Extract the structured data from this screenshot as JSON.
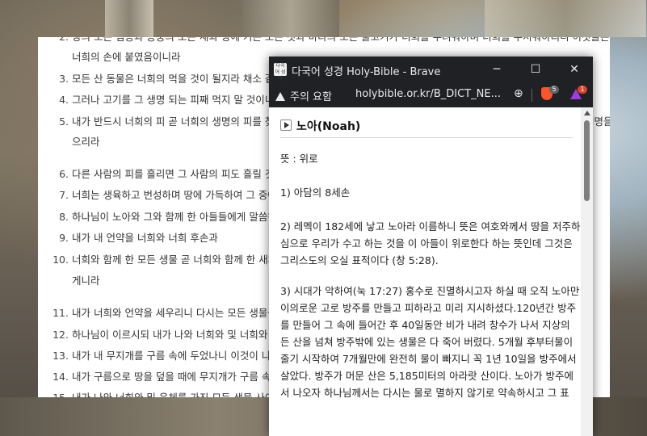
{
  "background_page": {
    "verses": [
      {
        "num": "2.",
        "text": "땅의 모든 짐승과 공중의 모든 새와 땅에 기는 모든 것과 바다의 모든 물고기가 너희를 두려워하며 너희를 무서워하리니 이것들은"
      },
      {
        "num": "",
        "text": "너희의 손에 붙였음이니라"
      },
      {
        "num": "3.",
        "text": "모든 산 동물은 너희의 먹을 것이 될지라 채소 같이 내가 이것을 다 너희에게 주노라"
      },
      {
        "num": "4.",
        "text": "그러나 고기를 그 생명 되는 피째 먹지 말 것이니라"
      },
      {
        "num": "5.",
        "text": "내가 반드시 너희의 피 곧 너희의 생명의 피를 찾으리니 짐승이면 그 짐승에게서, 사람이나 사람의 형제면 그에게서 사람의 생명을 찾"
      },
      {
        "num": "",
        "text": "으리라"
      },
      {
        "num": "6.",
        "text": "다른 사람의 피를 흘리면 그 사람의 피도 흘릴 것이니"
      },
      {
        "num": "7.",
        "text": "너희는 생육하고 번성하며 땅에 가득하여 그 중에서 번성하라 하셨더라"
      },
      {
        "num": "8.",
        "text": "하나님이 노아와 그와 함께 한 아들들에게 말씀하여 이르시되"
      },
      {
        "num": "9.",
        "text": "내가 내 언약을 너희와 너희 후손과"
      },
      {
        "num": "10.",
        "text": "너희와 함께 한 모든 생물 곧 너희와 함께 한 새와 가축과 땅의 모든 생물에게 세우리니 방주에서 나온 모든 것 곧 땅의 모든"
      },
      {
        "num": "",
        "text": "게니라"
      },
      {
        "num": "11.",
        "text": "내가 너희와 언약을 세우리니 다시는 모든 생물을 홍수로 멸하지 아니할 것이라"
      },
      {
        "num": "12.",
        "text": "하나님이 이르시되 내가 나와 너희와 및 너희와 함께 하는 모든 생물 사이에 대대로 영원히 세우는 언약의 증거는 이것이니라"
      },
      {
        "num": "13.",
        "text": "내가 내 무지개를 구름 속에 두었나니 이것이 나와 세상 사이의 언약의 증거니라"
      },
      {
        "num": "14.",
        "text": "내가 구름으로 땅을 덮을 때에 무지개가 구름 속에 나타나면"
      },
      {
        "num": "15.",
        "text": "내가 나와 너희와 및 육체를 가진 모든 생물 사이의 내 언약을 기억하리니"
      }
    ]
  },
  "popup": {
    "window_title": "다국어 성경 Holy-Bible - Brave",
    "app_icon_text": "다국어 성경",
    "controls": {
      "minimize": "─",
      "maximize": "☐",
      "close": "✕"
    },
    "security_label": "주의 요함",
    "url": "holybible.or.kr/B_DICT_NE...",
    "shields_count": "5",
    "rewards_count": "1",
    "heading": "노아(Noah)",
    "lines": [
      "뜻 : 위로",
      "1) 아담의 8세손",
      "2) 레멕이 182세에 낳고 노아라 이름하니 뜻은 여호와께서 땅을 저주하",
      "심으로 우리가 수고 하는 것을 이 아들이 위로한다 하는 뜻인데 그것은",
      "그리스도의 오실 표적이다 (창 5:28).",
      "3) 시대가 악하여(눅 17:27) 홍수로 진멸하시고자 하실 때 오직 노아만",
      "이의로운 고로 방주를 만들고 피하라고 미리 지시하셨다.120년간 방주",
      "를 만들어 그 속에 들어간 후 40일동안 비가 내려 창수가 나서 지상의",
      "든 산을 넘쳐 방주밖에 있는 생물은 다 죽어 버렸다. 5개월 후부터물이",
      "줄기 시작하여 7개월만에 완전히 물이 빠지니 꼭 1년 10일을 방주에서",
      "살았다. 방주가 머문 산은 5,185미터의 아라랏 산이다. 노아가 방주에",
      "서 나오자 하나님께서는 다시는 물로 멸하지 않기로 약속하시고 그 표"
    ]
  },
  "colors": {
    "link_blue": "#2a4fb6",
    "titlebar": "#202124",
    "brave_orange": "#fb542b",
    "brave_purple": "#9b3de0"
  }
}
